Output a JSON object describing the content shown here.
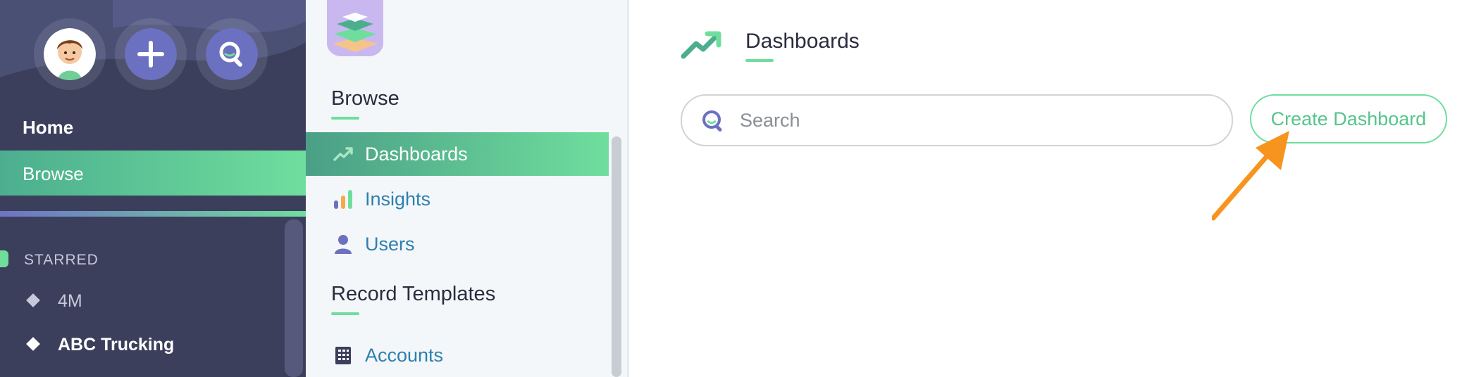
{
  "leftnav": {
    "home_label": "Home",
    "browse_label": "Browse",
    "starred_label": "STARRED",
    "starred_items": [
      {
        "label": "4M"
      },
      {
        "label": "ABC Trucking"
      }
    ],
    "icons": [
      "avatar",
      "plus-icon",
      "search-icon"
    ]
  },
  "middle": {
    "browse_title": "Browse",
    "browse_items": [
      {
        "label": "Dashboards",
        "icon": "trend-up-icon",
        "active": true
      },
      {
        "label": "Insights",
        "icon": "bar-chart-icon",
        "active": false
      },
      {
        "label": "Users",
        "icon": "user-icon",
        "active": false
      }
    ],
    "templates_title": "Record Templates",
    "template_items": [
      {
        "label": "Accounts",
        "icon": "building-icon"
      }
    ]
  },
  "main": {
    "title": "Dashboards",
    "search_placeholder": "Search",
    "search_value": "",
    "create_button_label": "Create Dashboard"
  },
  "colors": {
    "accent_green": "#6fde9d",
    "nav_bg": "#3b3f5c",
    "link_blue": "#2e7fb0",
    "arrow_orange": "#f7941d"
  }
}
